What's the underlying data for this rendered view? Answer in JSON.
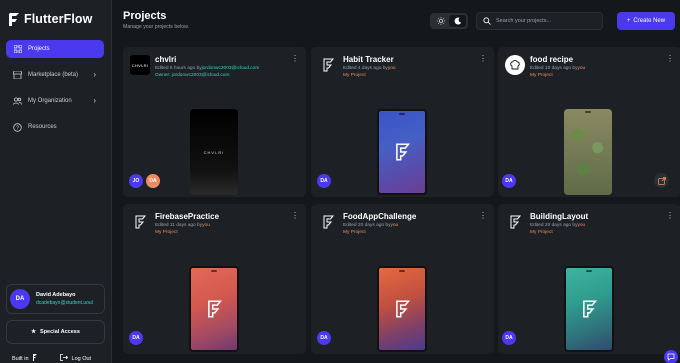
{
  "app": {
    "name": "FlutterFlow"
  },
  "sidebar": {
    "items": [
      {
        "label": "Projects",
        "icon": "grid-icon",
        "active": true
      },
      {
        "label": "Marketplace (beta)",
        "icon": "store-icon"
      },
      {
        "label": "My Organization",
        "icon": "people-icon"
      },
      {
        "label": "Resources",
        "icon": "help-circle-icon"
      }
    ],
    "user": {
      "initials": "DA",
      "name": "David Adebayo",
      "email": "dcadebayo@student.uoul"
    },
    "special_access": "Special Access",
    "built_in": "Built in",
    "log_out": "Log Out"
  },
  "header": {
    "title": "Projects",
    "subtitle": "Manage your projects below.",
    "search_placeholder": "Search your projects...",
    "create_label": "Create New"
  },
  "projects": [
    {
      "name": "chvlri",
      "edited": "Edited 6 hours ago by",
      "editor": "jordonwc2003@icloud.com",
      "owner": "Owner: jordonwc2003@icloud.com",
      "thumb_text": "CHVLRI",
      "avatars": [
        "JO",
        "DA"
      ]
    },
    {
      "name": "Habit Tracker",
      "edited": "Edited 4 days ago by",
      "editor": "you",
      "tag": "My Project",
      "avatars": [
        "DA"
      ]
    },
    {
      "name": "food recipe",
      "edited": "Edited 10 days ago by",
      "editor": "you",
      "tag": "My Project",
      "avatars": [
        "DA"
      ]
    },
    {
      "name": "FirebasePractice",
      "edited": "Edited 11 days ago by",
      "editor": "you",
      "tag": "My Project",
      "avatars": [
        "DA"
      ]
    },
    {
      "name": "FoodAppChallenge",
      "edited": "Edited 20 days ago by",
      "editor": "you",
      "tag": "My Project",
      "avatars": [
        "DA"
      ]
    },
    {
      "name": "BuildingLayout",
      "edited": "Edited 20 days ago by",
      "editor": "you",
      "tag": "My Project",
      "avatars": [
        "DA"
      ]
    }
  ],
  "colors": {
    "accent": "#4b39ef",
    "secondary": "#39d2c0",
    "tertiary": "#ee8b60",
    "bg": "#14181b",
    "surface": "#1d2125"
  }
}
